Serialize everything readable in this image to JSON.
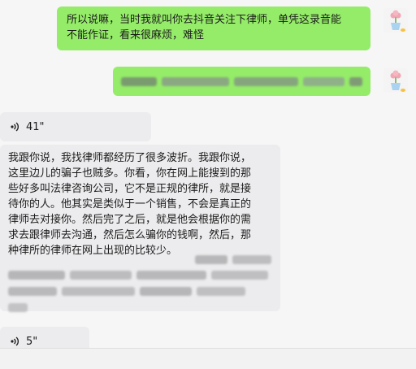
{
  "messages": {
    "msg1": {
      "text": "所以说嘛，当时我就叫你去抖音关注下律师，单凭这录音能\n不能作证，看来很麻烦，难怪"
    },
    "voice1": {
      "duration": "41\""
    },
    "msg3": {
      "text": "我跟你说，我找律师都经历了很多波折。我跟你说，\n这里边儿的骗子也贼多。你看，你在网上能搜到的那\n些好多叫法律咨询公司，它不是正规的律所，就是接\n待你的人。他其实是类似于一个销售，不会是真正的\n律师去对接你。然后完了之后，就是他会根据你的需\n求去跟律师去沟通，然后怎么骗你的钱啊，然后，那\n种律所的律师在网上出现的比较少。"
    },
    "voice2": {
      "duration": "5\""
    }
  },
  "icons": {
    "voice": "sound-wave-icon",
    "avatar": "flower-pot-avatar"
  },
  "colors": {
    "outgoing_bubble": "#95ec69",
    "incoming_bubble": "#ececee",
    "background": "#f6f6f6"
  }
}
